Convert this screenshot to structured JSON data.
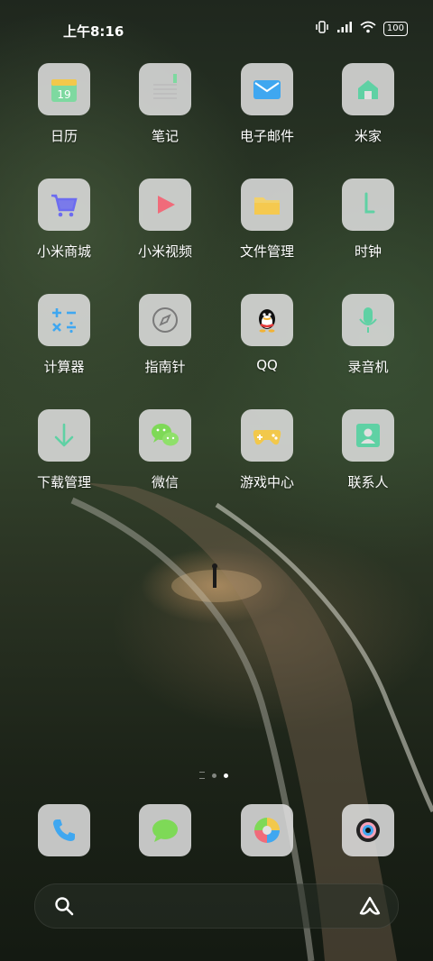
{
  "status_bar": {
    "time": "上午8:16",
    "battery": "100"
  },
  "apps": [
    {
      "label": "日历",
      "icon": "calendar-icon",
      "badge": "19"
    },
    {
      "label": "笔记",
      "icon": "notes-icon"
    },
    {
      "label": "电子邮件",
      "icon": "email-icon"
    },
    {
      "label": "米家",
      "icon": "mijia-icon"
    },
    {
      "label": "小米商城",
      "icon": "shopping-cart-icon"
    },
    {
      "label": "小米视频",
      "icon": "video-play-icon"
    },
    {
      "label": "文件管理",
      "icon": "folder-icon"
    },
    {
      "label": "时钟",
      "icon": "clock-icon"
    },
    {
      "label": "计算器",
      "icon": "calculator-icon"
    },
    {
      "label": "指南针",
      "icon": "compass-icon"
    },
    {
      "label": "QQ",
      "icon": "qq-penguin-icon"
    },
    {
      "label": "录音机",
      "icon": "microphone-icon"
    },
    {
      "label": "下载管理",
      "icon": "download-icon"
    },
    {
      "label": "微信",
      "icon": "wechat-icon"
    },
    {
      "label": "游戏中心",
      "icon": "gamepad-icon"
    },
    {
      "label": "联系人",
      "icon": "contacts-icon"
    }
  ],
  "dock": [
    {
      "icon": "phone-icon"
    },
    {
      "icon": "message-icon"
    },
    {
      "icon": "browser-icon"
    },
    {
      "icon": "camera-icon"
    }
  ],
  "colors": {
    "calendar_green": "#7ed9a0",
    "mail_blue": "#3fa7f0",
    "teal_green": "#5fd1a4",
    "purple": "#6c6cf0",
    "video_red": "#f06b7a",
    "folder_yellow": "#f2d16b",
    "calc_blue": "#3fa7f0",
    "game_yellow": "#f2c84b"
  }
}
